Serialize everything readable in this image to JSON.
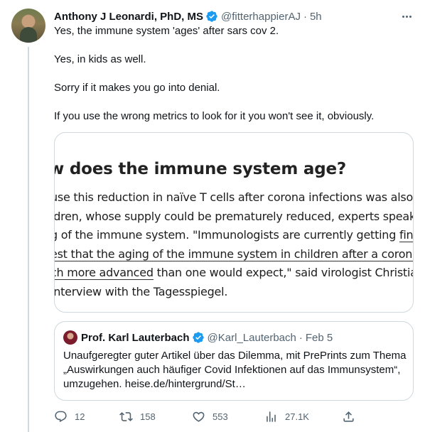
{
  "tweet": {
    "author_name": "Anthony J Leonardi, PhD, MS",
    "handle": "@fitterhappierAJ",
    "separator": "·",
    "time": "5h",
    "paragraphs": [
      "Yes, the immune system 'ages' after sars cov 2.",
      "Yes, in kids as well.",
      "Sorry if it makes you go into denial.",
      "If you use the wrong metrics to look for it you won't see it, obviously."
    ]
  },
  "media": {
    "heading": "w does the immune system age?",
    "lines": [
      {
        "parts": [
          {
            "text": "use this reduction in naïve T cells after corona infections was also observ",
            "u": false
          }
        ]
      },
      {
        "parts": [
          {
            "text": "ldren, whose supply could be prematurely reduced, experts speak of an",
            "u": false
          }
        ]
      },
      {
        "parts": [
          {
            "text": "g of the immune system. \"Immunologists are currently getting ",
            "u": false
          },
          {
            "text": "findings th",
            "u": true
          }
        ]
      },
      {
        "parts": [
          {
            "text": "est that the aging of the immune system in children after a corona infecti",
            "u": true
          }
        ]
      },
      {
        "parts": [
          {
            "text": "ch more advanced",
            "u": true
          },
          {
            "text": " than one would expect,\" said virologist Christian Dros",
            "u": false
          }
        ]
      },
      {
        "parts": [
          {
            "text": " interview with the Tagesspiegel.",
            "u": false
          }
        ]
      }
    ]
  },
  "quote": {
    "author_name": "Prof. Karl Lauterbach",
    "handle": "@Karl_Lauterbach",
    "separator": "·",
    "date": "Feb 5",
    "text": "Unaufgeregter guter Artikel über das Dilemma, mit PrePrints zum Thema „Auswirkungen auch häufiger Covid Infektionen auf das Immunsystem“, umzugehen.  heise.de/hintergrund/St…"
  },
  "actions": {
    "replies": "12",
    "retweets": "158",
    "likes": "553",
    "views": "27.1K"
  },
  "colors": {
    "verified": "#1d9bf0",
    "secondary_text": "#536471",
    "border": "#cfd9de"
  },
  "icons": [
    "verified-badge-icon",
    "more-icon",
    "reply-icon",
    "retweet-icon",
    "like-icon",
    "views-icon",
    "share-icon"
  ]
}
